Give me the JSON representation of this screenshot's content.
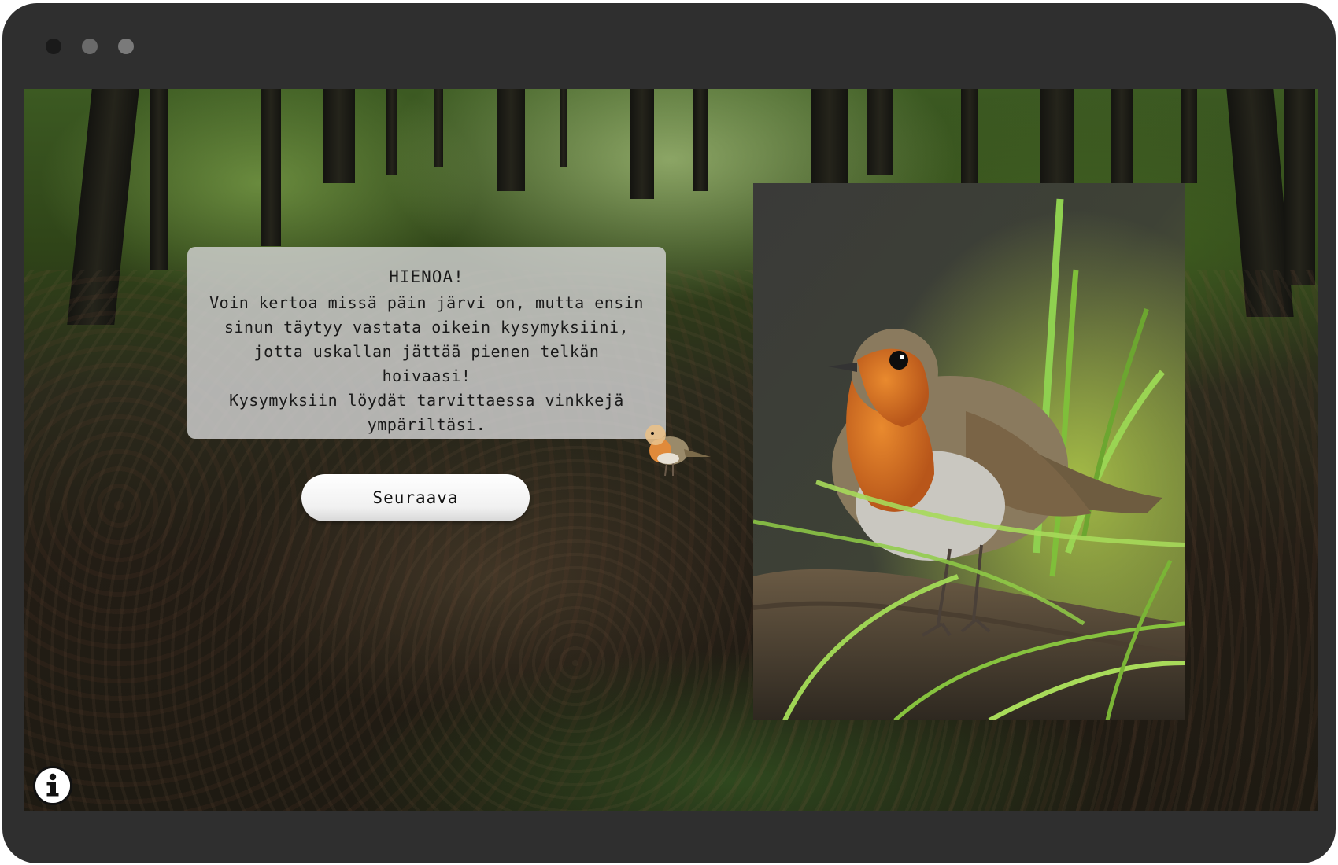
{
  "dialog": {
    "title": "HIENOA!",
    "body": "Voin kertoa missä päin järvi on, mutta ensin\nsinun täytyy vastata oikein kysymyksiini,\njotta uskallan jättää pienen telkän hoivaasi!\nKysymyksiin löydät tarvittaessa vinkkejä\nympäriltäsi."
  },
  "buttons": {
    "next_label": "Seuraava"
  },
  "icons": {
    "info": "info-icon",
    "bird": "robin-icon"
  },
  "colors": {
    "window_frame": "#2f2f2f",
    "dialog_bg": "#d2d2d2",
    "robin_breast": "#d9731e",
    "grass": "#8cc63f"
  }
}
